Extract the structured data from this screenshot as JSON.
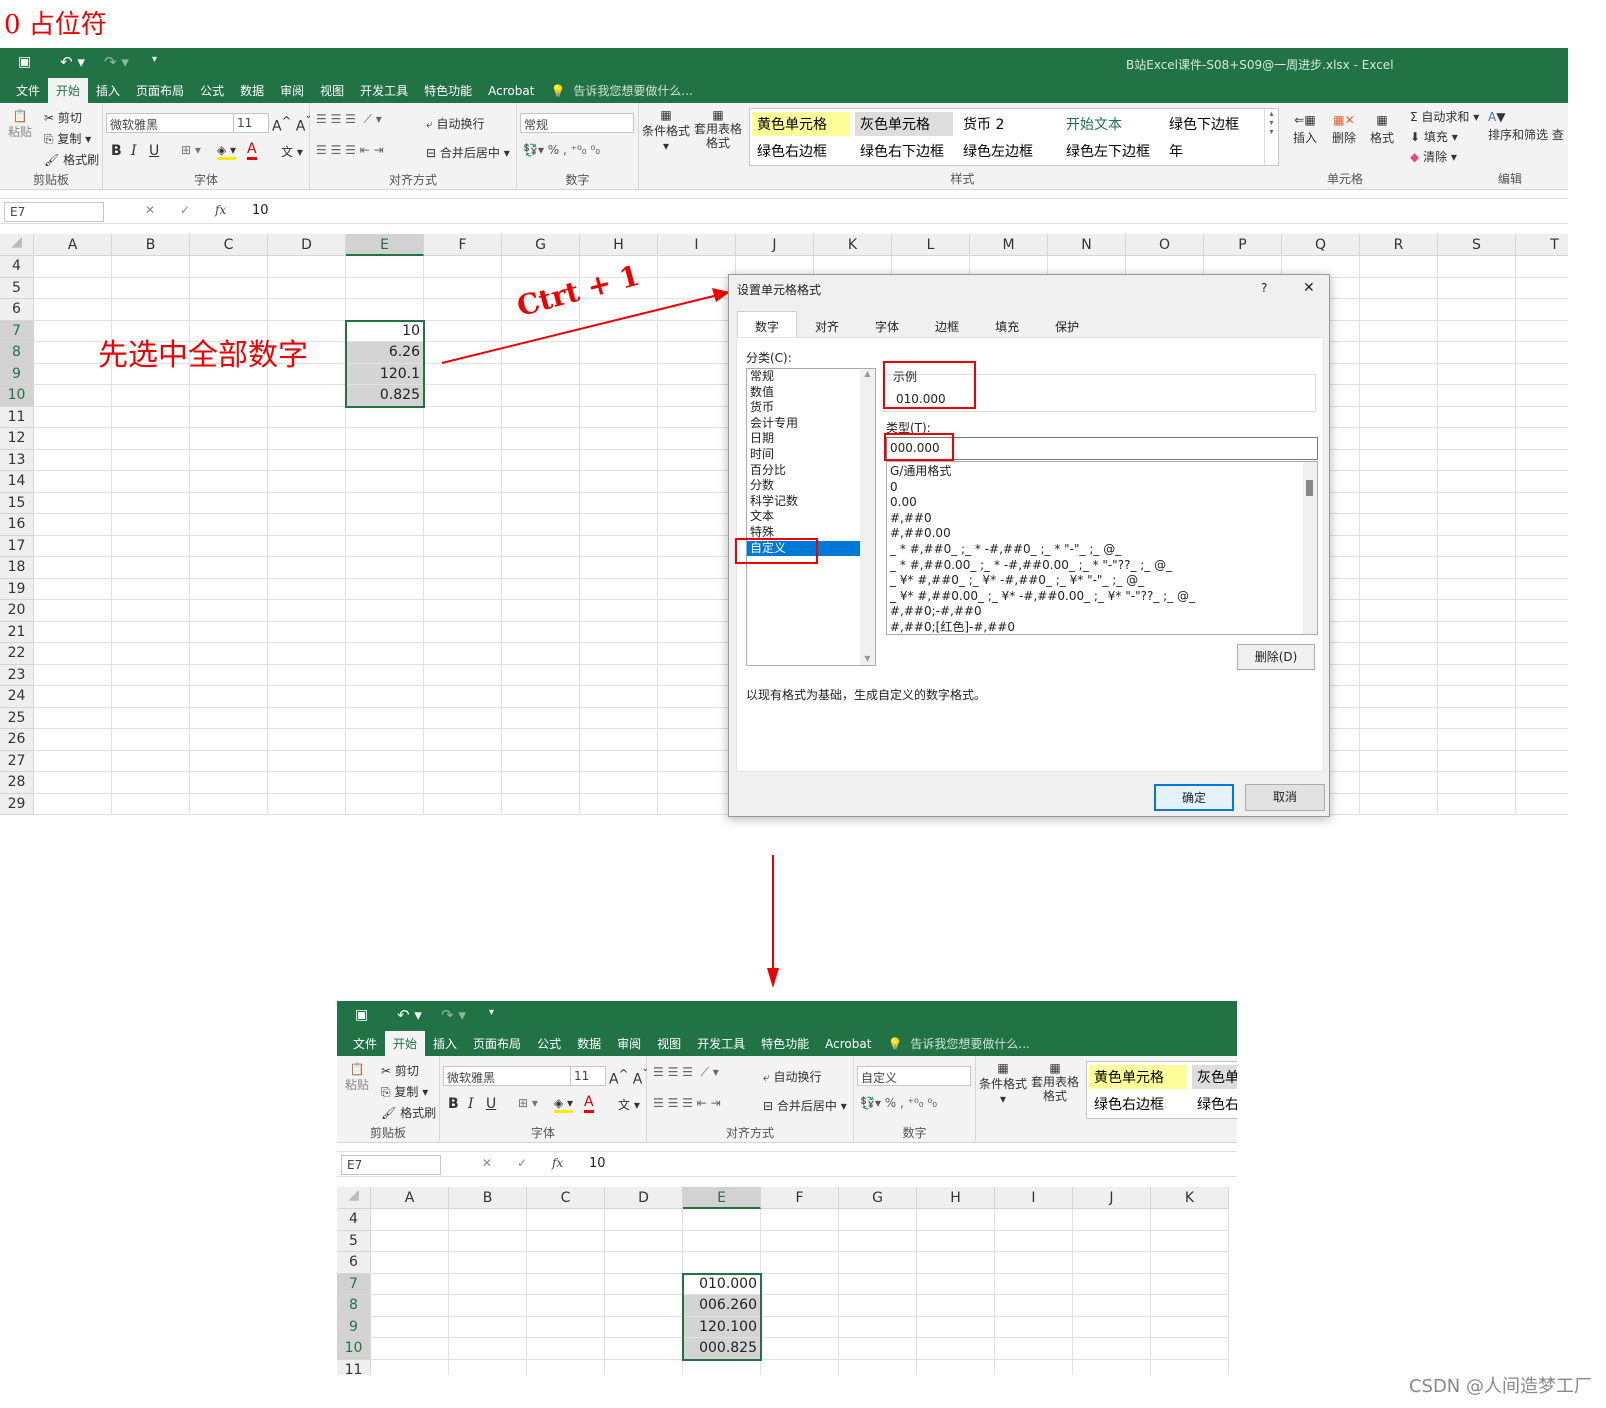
{
  "heading": "0 占位符",
  "annotation": {
    "select_text": "先选中全部数字",
    "shortcut": "Ctrt + 1"
  },
  "excel": {
    "title": "B站Excel课件-S08+S09@一周进步.xlsx - Excel",
    "tabs": [
      "文件",
      "开始",
      "插入",
      "页面布局",
      "公式",
      "数据",
      "审阅",
      "视图",
      "开发工具",
      "特色功能",
      "Acrobat"
    ],
    "tell_me": "告诉我您想要做什么...",
    "clipboard": {
      "paste": "粘贴",
      "cut": "剪切",
      "copy": "复制",
      "painter": "格式刷",
      "label": "剪贴板"
    },
    "font": {
      "name": "微软雅黑",
      "size": "11",
      "label": "字体",
      "bold": "B",
      "italic": "I",
      "underline": "U"
    },
    "align": {
      "wrap": "自动换行",
      "merge": "合并后居中",
      "label": "对齐方式"
    },
    "number": {
      "format_top": "常规",
      "format_bottom": "自定义",
      "label": "数字",
      "percent": "%",
      "comma": ","
    },
    "cond": "条件格式",
    "table": "套用表格格式",
    "styles": {
      "label": "样式",
      "items": [
        "黄色单元格",
        "灰色单元格",
        "货币 2",
        "开始文本",
        "绿色下边框",
        "绿色右边框",
        "绿色右下边框",
        "绿色左边框",
        "绿色左下边框",
        "年"
      ]
    },
    "cells": {
      "insert": "插入",
      "delete": "删除",
      "format": "格式",
      "label": "单元格"
    },
    "edit": {
      "autosum": "自动求和",
      "fill": "填充",
      "clear": "清除",
      "sort": "排序和筛选",
      "find": "查",
      "label": "编辑"
    },
    "namebox": "E7",
    "formula": "10",
    "fx": "fx",
    "columns_top": [
      "A",
      "B",
      "C",
      "D",
      "E",
      "F",
      "G",
      "H",
      "I",
      "J",
      "K",
      "L",
      "M",
      "N",
      "O",
      "P",
      "Q",
      "R",
      "S",
      "T"
    ],
    "columns_bottom": [
      "A",
      "B",
      "C",
      "D",
      "E",
      "F",
      "G",
      "H",
      "I",
      "J",
      "K"
    ],
    "values_before": [
      "10",
      "6.26",
      "120.1",
      "0.825"
    ],
    "values_after": [
      "010.000",
      "006.260",
      "120.100",
      "000.825"
    ]
  },
  "dialog": {
    "title": "设置单元格格式",
    "help": "?",
    "close": "✕",
    "tabs": [
      "数字",
      "对齐",
      "字体",
      "边框",
      "填充",
      "保护"
    ],
    "category_label": "分类(C):",
    "categories": [
      "常规",
      "数值",
      "货币",
      "会计专用",
      "日期",
      "时间",
      "百分比",
      "分数",
      "科学记数",
      "文本",
      "特殊",
      "自定义"
    ],
    "sample_label": "示例",
    "sample_value": "010.000",
    "type_label": "类型(T):",
    "type_value": "000.000",
    "types": [
      "G/通用格式",
      "0",
      "0.00",
      "#,##0",
      "#,##0.00",
      "_ * #,##0_ ;_ * -#,##0_ ;_ * \"-\"_ ;_ @_",
      "_ * #,##0.00_ ;_ * -#,##0.00_ ;_ * \"-\"??_ ;_ @_",
      "_ ¥* #,##0_ ;_ ¥* -#,##0_ ;_ ¥* \"-\"_ ;_ @_",
      "_ ¥* #,##0.00_ ;_ ¥* -#,##0.00_ ;_ ¥* \"-\"??_ ;_ @_",
      "#,##0;-#,##0",
      "#,##0;[红色]-#,##0"
    ],
    "delete": "删除(D)",
    "description": "以现有格式为基础，生成自定义的数字格式。",
    "ok": "确定",
    "cancel": "取消"
  },
  "watermark": "CSDN @人间造梦工厂",
  "colors": {
    "excel_green": "#217346",
    "annotation_red": "#e00000",
    "selection_blue": "#0078d7"
  }
}
